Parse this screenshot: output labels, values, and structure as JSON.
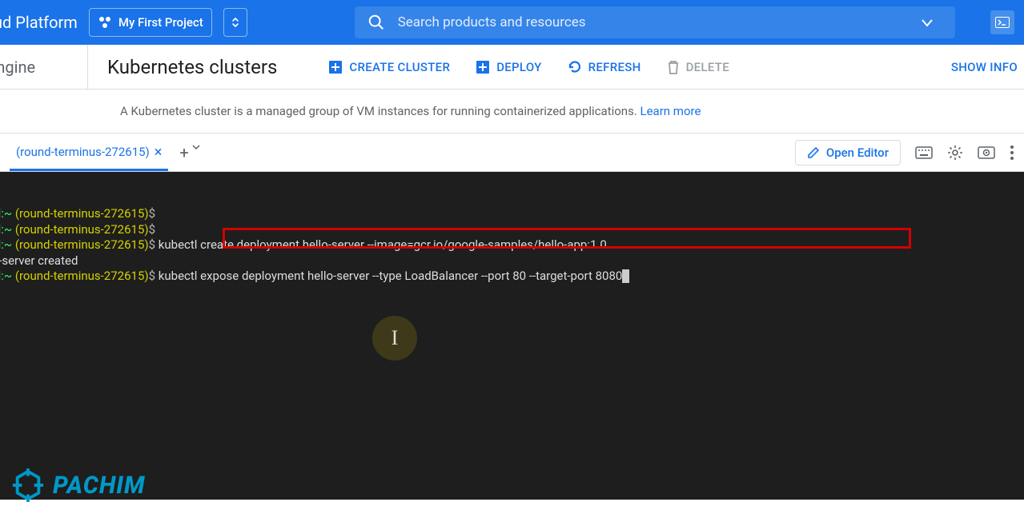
{
  "header": {
    "platform_label": "ud Platform",
    "project_name": "My First Project",
    "search_placeholder": "Search products and resources"
  },
  "subheader": {
    "engine_label": "Engine",
    "page_title": "Kubernetes clusters",
    "actions": {
      "create": "CREATE CLUSTER",
      "deploy": "DEPLOY",
      "refresh": "REFRESH",
      "delete": "DELETE"
    },
    "show_info": "SHOW INFO"
  },
  "description": {
    "text": "A Kubernetes cluster is a managed group of VM instances for running containerized applications. ",
    "link": "Learn more"
  },
  "shell": {
    "tab_name": "(round-terminus-272615)",
    "open_editor": "Open Editor"
  },
  "terminal": {
    "project_id": "round-terminus-272615",
    "lines": [
      {
        "host": "ell:~",
        "project": "(round-terminus-272615)",
        "cmd": ""
      },
      {
        "host": "ell:~",
        "project": "(round-terminus-272615)",
        "cmd": ""
      },
      {
        "host": "ell:~",
        "project": "(round-terminus-272615)",
        "cmd": "kubectl create deployment hello-server --image=gcr.io/google-samples/hello-app:1.0"
      },
      {
        "plain": "lo-server created"
      },
      {
        "host": "ell:~",
        "project": "(round-terminus-272615)",
        "cmd": "kubectl expose deployment hello-server --type LoadBalancer --port 80 --target-port 8080",
        "cursor": true
      }
    ]
  },
  "watermark": {
    "text": "PACHIM"
  }
}
